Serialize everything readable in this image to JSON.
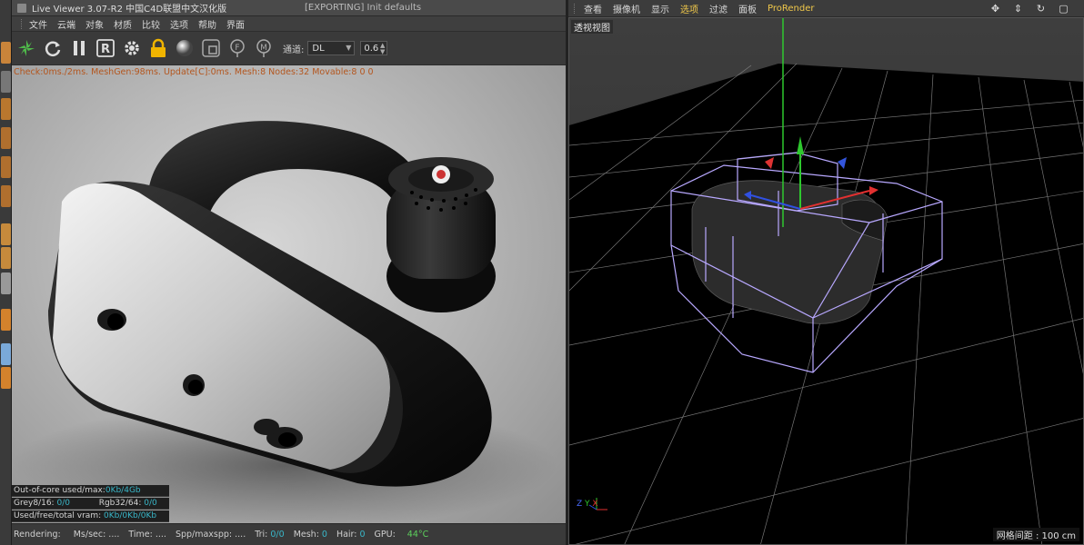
{
  "left_viewer": {
    "window_title": "Live Viewer 3.07-R2 中国C4D联盟中文汉化版",
    "export_status": "[EXPORTING] Init defaults",
    "menu": [
      "文件",
      "云端",
      "对象",
      "材质",
      "比较",
      "选项",
      "帮助",
      "界面"
    ],
    "toolbar": {
      "icons": [
        "octane-logo-icon",
        "refresh-icon",
        "pause-icon",
        "r-button-icon",
        "gear-icon",
        "lock-icon",
        "material-ball-icon",
        "region-icon",
        "focus-pick-icon",
        "material-pick-icon"
      ],
      "channel_label": "通道:",
      "channel_value": "DL",
      "value": "0.6"
    },
    "render_stats": "Check:0ms./2ms. MeshGen:98ms. Update[C]:0ms. Mesh:8 Nodes:32 Movable:8  0 0",
    "memory": {
      "out_of_core_label": "Out-of-core used/max:",
      "out_of_core_value": "0Kb/4Gb",
      "grey_label": "Grey8/16:",
      "grey_value": "0/0",
      "rgb_label": "Rgb32/64:",
      "rgb_value": "0/0",
      "vram_label": "Used/free/total vram:",
      "vram_value": "0Kb/0Kb/0Kb"
    },
    "status": {
      "rendering_label": "Rendering:",
      "ms_label": "Ms/sec:",
      "ms_value": "....",
      "time_label": "Time:",
      "time_value": "....",
      "spp_label": "Spp/maxspp:",
      "spp_value": "....",
      "tri_label": "Tri:",
      "tri_value": "0/0",
      "mesh_label": "Mesh:",
      "mesh_value": "0",
      "hair_label": "Hair:",
      "hair_value": "0",
      "gpu_label": "GPU:",
      "gpu_value": "44°C"
    }
  },
  "right_viewport": {
    "menu": [
      "查看",
      "摄像机",
      "显示",
      "选项",
      "过滤",
      "面板",
      "ProRender"
    ],
    "active_menu": "选项",
    "view_label": "透视视图",
    "grid_spacing": "网格间距 : 100 cm",
    "axes": [
      "Z",
      "Y",
      "X"
    ]
  },
  "colors": {
    "accent_yellow": "#f0c84a",
    "stat_orange": "#b4561e",
    "value_cyan": "#39b7c9",
    "bbox_purple": "#b8a8ff"
  }
}
